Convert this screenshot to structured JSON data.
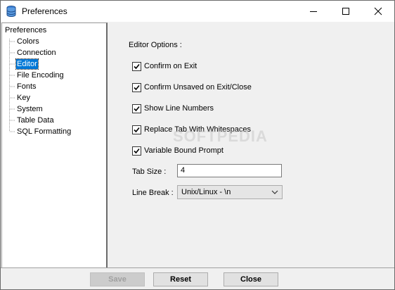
{
  "window": {
    "title": "Preferences"
  },
  "tree": {
    "root": "Preferences",
    "items": [
      {
        "label": "Colors",
        "selected": false
      },
      {
        "label": "Connection",
        "selected": false
      },
      {
        "label": "Editor",
        "selected": true
      },
      {
        "label": "File Encoding",
        "selected": false
      },
      {
        "label": "Fonts",
        "selected": false
      },
      {
        "label": "Key",
        "selected": false
      },
      {
        "label": "System",
        "selected": false
      },
      {
        "label": "Table Data",
        "selected": false
      },
      {
        "label": "SQL Formatting",
        "selected": false
      }
    ]
  },
  "editor": {
    "section_title": "Editor Options :",
    "options": [
      {
        "label": "Confirm on Exit",
        "checked": true
      },
      {
        "label": "Confirm Unsaved on Exit/Close",
        "checked": true
      },
      {
        "label": "Show Line Numbers",
        "checked": true
      },
      {
        "label": "Replace Tab With Whitespaces",
        "checked": true
      },
      {
        "label": "Variable Bound Prompt",
        "checked": true
      }
    ],
    "tab_size_label": "Tab Size :",
    "tab_size_value": "4",
    "line_break_label": "Line Break :",
    "line_break_value": "Unix/Linux - \\n"
  },
  "watermark": "SOFTPEDIA",
  "buttons": {
    "save": "Save",
    "reset": "Reset",
    "close": "Close"
  },
  "colors": {
    "selection": "#0078d7",
    "background": "#f0f0f0"
  },
  "icons": {
    "app": "database-icon",
    "check": "check-icon",
    "dropdown": "chevron-down-icon"
  }
}
